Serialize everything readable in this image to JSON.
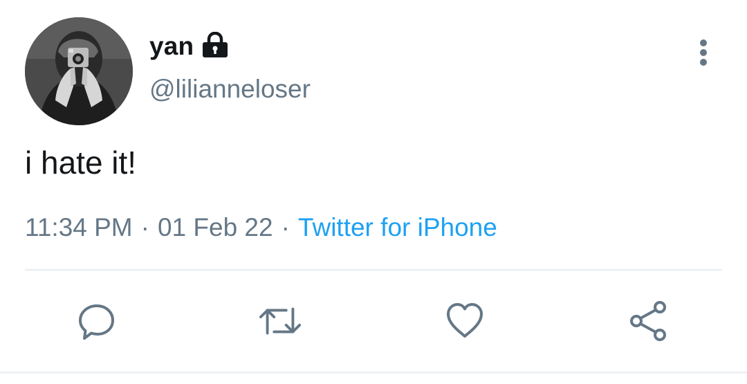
{
  "user": {
    "display_name": "yan",
    "handle": "@lilianneloser",
    "protected": true
  },
  "tweet": {
    "text": "i hate it!",
    "time": "11:34 PM",
    "separator": "·",
    "date": "01 Feb 22",
    "source": "Twitter for iPhone"
  },
  "icons": {
    "lock": "lock-icon",
    "more": "more-vertical-icon",
    "reply": "reply-icon",
    "retweet": "retweet-icon",
    "like": "heart-icon",
    "share": "share-icon"
  },
  "colors": {
    "text_primary": "#14171a",
    "text_secondary": "#657786",
    "link": "#1da1f2",
    "divider": "#e6ecf0"
  }
}
